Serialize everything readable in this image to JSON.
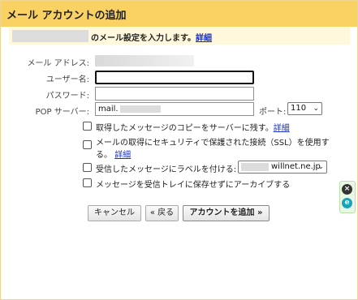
{
  "title": "メール アカウントの追加",
  "intro": {
    "text": "のメール設定を入力します。",
    "link": "詳細"
  },
  "form": {
    "email_label": "メール アドレス:",
    "username_label": "ユーザー名:",
    "username_value": "",
    "password_label": "パスワード:",
    "password_value": "",
    "pop_server_label": "POP サーバー:",
    "pop_server_value": "mail.",
    "port_label": "ポート:",
    "port_value": "110"
  },
  "options": {
    "leave_copy": "取得したメッセージのコピーをサーバーに残す。",
    "leave_copy_link": "詳細",
    "ssl_line1": "メールの取得にセキュリティで保護された接続（SSL）を使用す",
    "ssl_line2": "る。",
    "ssl_link": "詳細",
    "label_incoming": "受信したメッセージにラベルを付ける:",
    "label_select_value": "willnet.ne.jp",
    "archive": "メッセージを受信トレイに保存せずにアーカイブする"
  },
  "buttons": {
    "cancel": "キャンセル",
    "back": "« 戻る",
    "add_account": "アカウントを追加 »"
  },
  "colors": {
    "title_bar": "#fad163",
    "intro_bg": "#fff8dc",
    "link": "#1a33cc",
    "redaction": "#dcdcdc"
  }
}
